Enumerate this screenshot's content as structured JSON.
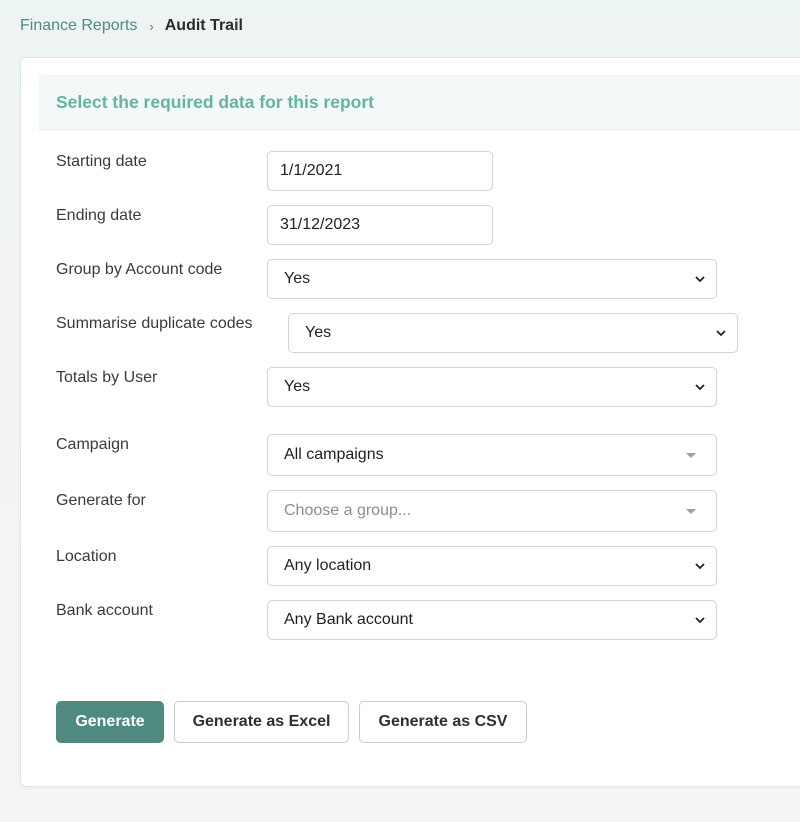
{
  "breadcrumb": {
    "parent": "Finance Reports",
    "separator": "›",
    "current": "Audit Trail"
  },
  "card": {
    "title": "Select the required data for this report"
  },
  "form": {
    "starting_date": {
      "label": "Starting date",
      "value": "1/1/2021"
    },
    "ending_date": {
      "label": "Ending date",
      "value": "31/12/2023"
    },
    "group_by_account": {
      "label": "Group by Account code",
      "value": "Yes"
    },
    "summarise_duplicates": {
      "label": "Summarise duplicate codes",
      "value": "Yes"
    },
    "totals_by_user": {
      "label": "Totals by User",
      "value": "Yes"
    },
    "campaign": {
      "label": "Campaign",
      "value": "All campaigns"
    },
    "generate_for": {
      "label": "Generate for",
      "placeholder": "Choose a group..."
    },
    "location": {
      "label": "Location",
      "value": "Any location"
    },
    "bank_account": {
      "label": "Bank account",
      "value": "Any Bank account"
    }
  },
  "buttons": {
    "generate": "Generate",
    "generate_excel": "Generate as Excel",
    "generate_csv": "Generate as CSV"
  },
  "colors": {
    "accent": "#65b2a6",
    "primary_button": "#4e8a80",
    "breadcrumb_link": "#4f8a84"
  },
  "icons": {
    "select_arrow": "chevron-down-icon",
    "chosen_arrow": "caret-down-icon"
  }
}
